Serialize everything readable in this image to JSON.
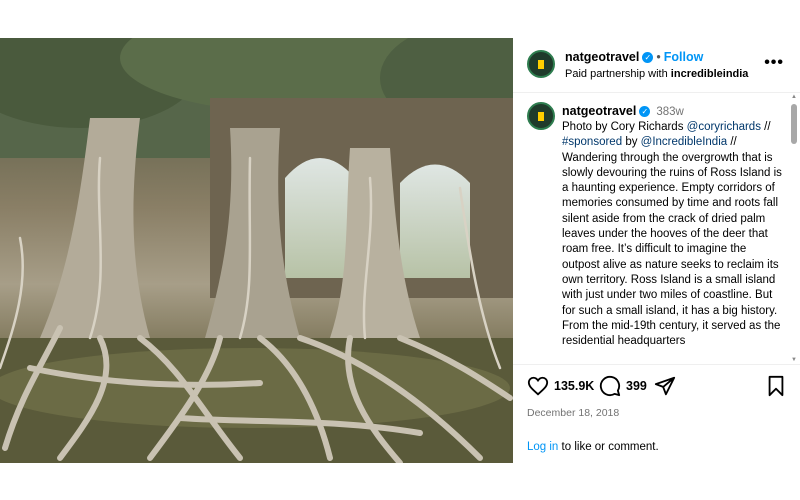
{
  "post": {
    "username": "natgeotravel",
    "separator": "•",
    "follow_label": "Follow",
    "partnership_prefix": "Paid partnership with",
    "partner": "incredibleindia",
    "more_label": "•••"
  },
  "caption": {
    "username": "natgeotravel",
    "time": "383w",
    "line1_prefix": "Photo by Cory Richards",
    "mention1": "@coryrichards",
    "line2_prefix": "//",
    "hashtag": "#sponsored",
    "by": "by",
    "mention2": "@IncredibleIndia",
    "line2_suffix": "//",
    "body": "Wandering through the overgrowth that is slowly devouring the ruins of Ross Island is a haunting experience. Empty corridors of memories consumed by time and roots fall silent aside from the crack of dried palm leaves under the hooves of the deer that roam free. It’s difficult to imagine the outpost alive as nature seeks to reclaim its own territory. Ross Island is a small island with just under two miles of coastline. But for such a small island, it has a big history. From the mid-19th century, it served as the residential headquarters"
  },
  "actions": {
    "likes": "135.9K",
    "comments": "399",
    "date": "December 18, 2018",
    "login_link": "Log in",
    "login_suffix": "to like or comment."
  },
  "icons": {
    "like": "heart-icon",
    "comment": "comment-bubble-icon",
    "share": "paper-plane-icon",
    "save": "bookmark-icon",
    "verified": "verified-badge-icon"
  },
  "colors": {
    "link_blue": "#0095f6",
    "mention_blue": "#00376b",
    "muted": "#737373"
  }
}
